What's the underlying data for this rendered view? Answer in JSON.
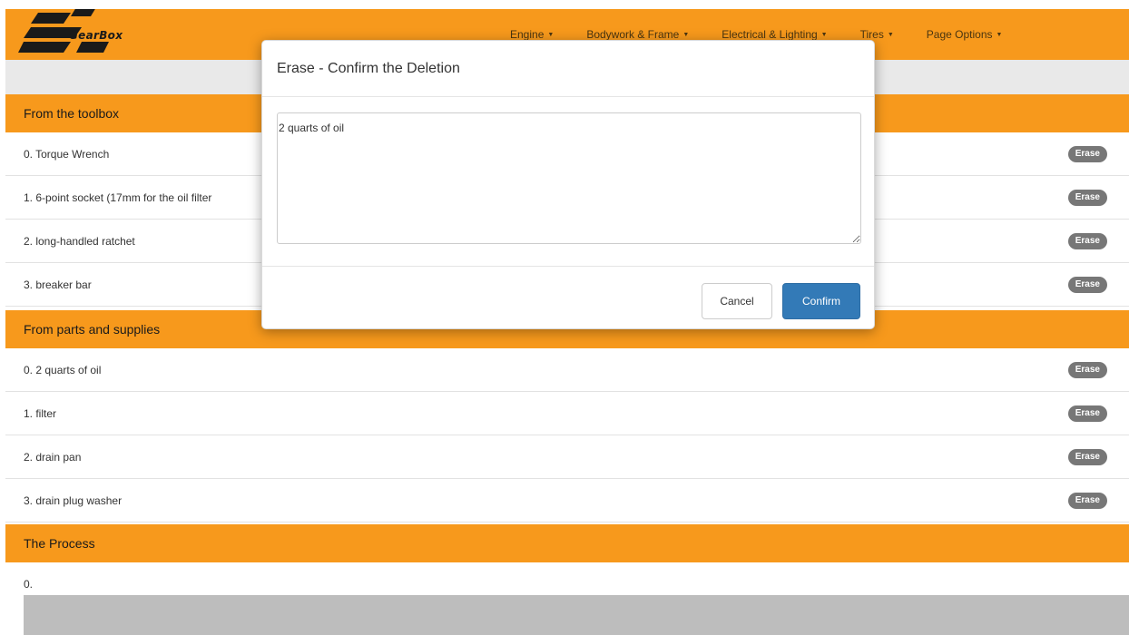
{
  "app": {
    "logo_text": "GearBox"
  },
  "nav": {
    "items": [
      {
        "label": "Engine"
      },
      {
        "label": "Bodywork & Frame"
      },
      {
        "label": "Electrical & Lighting"
      },
      {
        "label": "Tires"
      },
      {
        "label": "Page Options"
      }
    ]
  },
  "sections": {
    "toolbox": {
      "title": "From the toolbox",
      "items": [
        "0. Torque Wrench",
        "1. 6-point socket (17mm for the oil filter",
        "2. long-handled ratchet",
        "3. breaker bar"
      ]
    },
    "parts": {
      "title": "From parts and supplies",
      "items": [
        "0. 2 quarts of oil",
        "1. filter",
        "2. drain pan",
        "3. drain plug washer"
      ]
    },
    "process": {
      "title": "The Process",
      "items": [
        "0."
      ]
    }
  },
  "badge": {
    "erase_label": "Erase"
  },
  "modal": {
    "title": "Erase - Confirm the Deletion",
    "textarea_value": "2 quarts of oil",
    "cancel_label": "Cancel",
    "confirm_label": "Confirm"
  },
  "colors": {
    "brand_orange": "#f7991c",
    "primary_blue": "#337ab7",
    "badge_gray": "#777777"
  }
}
